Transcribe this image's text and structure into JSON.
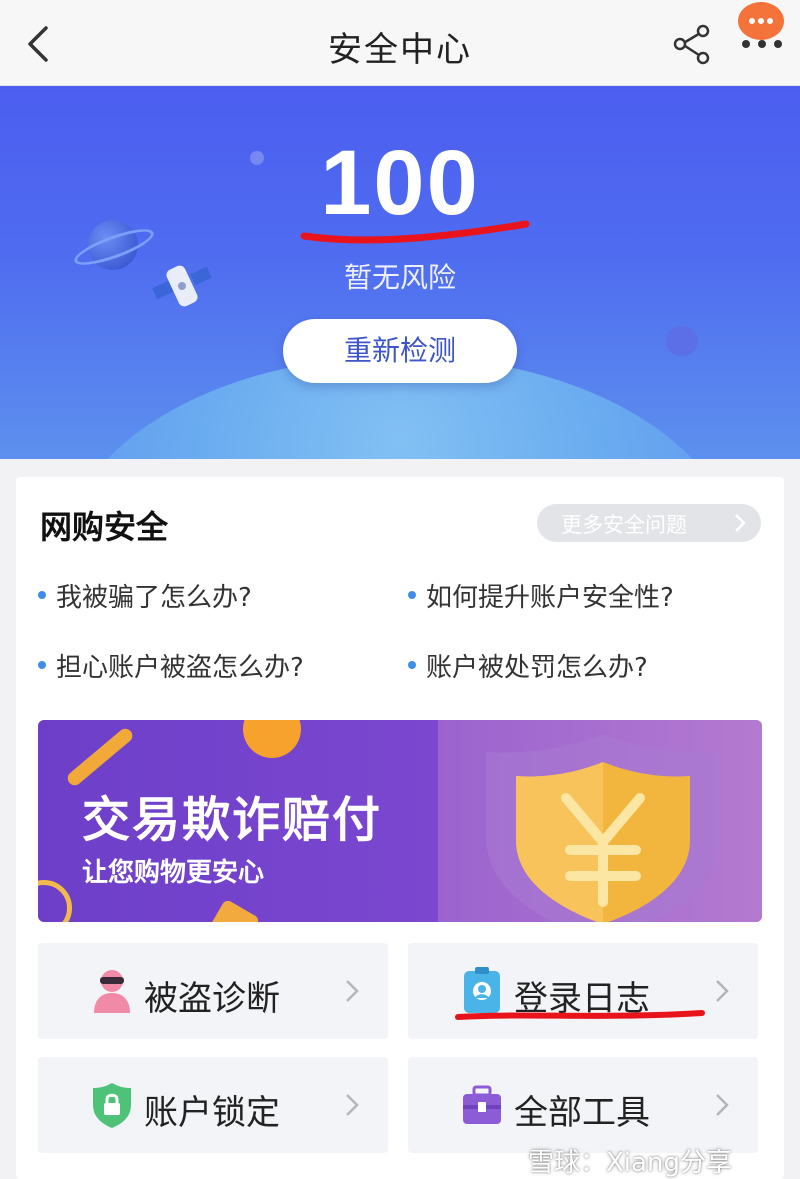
{
  "header": {
    "title": "安全中心"
  },
  "hero": {
    "score": "100",
    "risk_status": "暂无风险",
    "recheck_label": "重新检测"
  },
  "online_shopping_security": {
    "title": "网购安全",
    "more_issues_label": "更多安全问题",
    "faqs": [
      "我被骗了怎么办?",
      "如何提升账户安全性?",
      "担心账户被盗怎么办?",
      "账户被处罚怎么办?"
    ]
  },
  "banner": {
    "title": "交易欺诈赔付",
    "subtitle": "让您购物更安心"
  },
  "tools": [
    {
      "label": "被盗诊断",
      "icon": "thief-icon"
    },
    {
      "label": "登录日志",
      "icon": "id-badge-icon"
    },
    {
      "label": "账户锁定",
      "icon": "lock-shield-icon"
    },
    {
      "label": "全部工具",
      "icon": "toolbox-icon"
    }
  ],
  "watermark": "雪球：Xiang分享",
  "colors": {
    "hero_gradient_top": "#4c5ef0",
    "hero_gradient_bottom": "#5d90ee",
    "accent_blue": "#3d55c7",
    "more_button_orange": "#f4733a",
    "annotation_red": "#e8131b",
    "banner_purple": "#7a46cf"
  }
}
